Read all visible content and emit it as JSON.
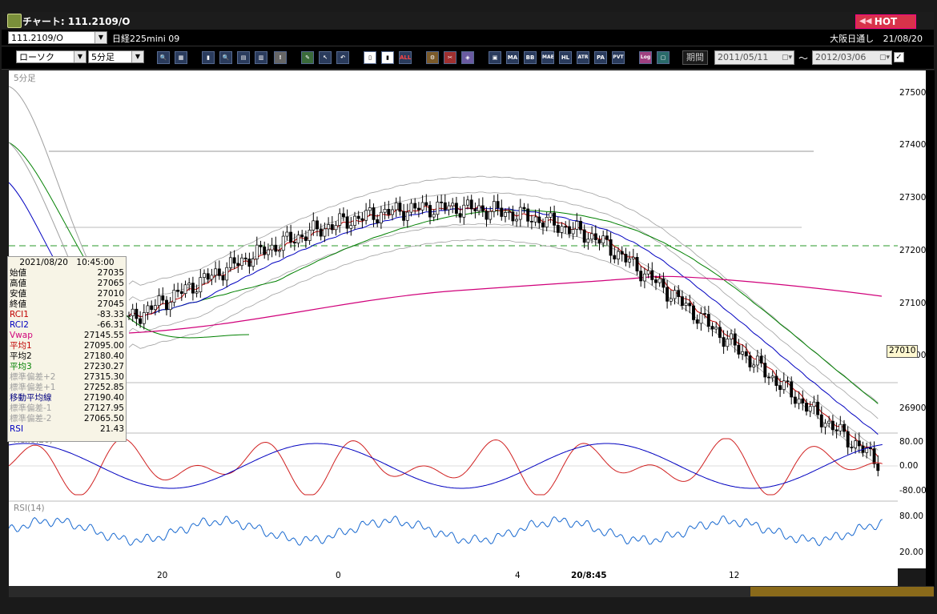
{
  "window": {
    "title": "チャート: 111.2109/O",
    "hot_label": "HOT"
  },
  "header": {
    "symbol_value": "111.2109/O",
    "instrument": "日経225mini 09",
    "session": "大阪日通し",
    "date": "21/08/20"
  },
  "toolbar": {
    "chart_type": "ローソク",
    "timeframe": "5分足",
    "period_label": "期間",
    "date_from": "2011/05/11",
    "date_to": "2012/03/06",
    "range_sep": "～",
    "indicator_buttons": [
      "MA",
      "BB",
      "MAE",
      "HL",
      "ATR",
      "PA",
      "PVT",
      "Log"
    ]
  },
  "chart": {
    "timeframe_label": "5分足",
    "price_ticks": [
      "27500",
      "27400",
      "27300",
      "27200",
      "27100",
      "27000",
      "26900"
    ],
    "current_price": "27010",
    "x_labels": [
      "20",
      "0",
      "4",
      "20/8:45",
      "12"
    ],
    "rci_label": "RCI(9,26)",
    "rci_ticks": [
      "80.00",
      "0.00",
      "-80.00"
    ],
    "rsi_label": "RSI(14)",
    "rsi_ticks": [
      "80.00",
      "20.00"
    ]
  },
  "info_panel": {
    "datetime": "2021/08/20　10:45:00",
    "rows": [
      {
        "label": "始値",
        "value": "27035",
        "color": "#000000"
      },
      {
        "label": "高値",
        "value": "27065",
        "color": "#000000"
      },
      {
        "label": "安値",
        "value": "27010",
        "color": "#000000"
      },
      {
        "label": "終値",
        "value": "27045",
        "color": "#000000"
      },
      {
        "label": "RCI1",
        "value": "-83.33",
        "color": "#c00000"
      },
      {
        "label": "RCI2",
        "value": "-66.31",
        "color": "#0000c0"
      },
      {
        "label": "Vwap",
        "value": "27145.55",
        "color": "#d0007a"
      },
      {
        "label": "平均1",
        "value": "27095.00",
        "color": "#c00000"
      },
      {
        "label": "平均2",
        "value": "27180.40",
        "color": "#000000"
      },
      {
        "label": "平均3",
        "value": "27230.27",
        "color": "#008000"
      },
      {
        "label": "標準偏差+2",
        "value": "27315.30",
        "color": "#a0a0a0"
      },
      {
        "label": "標準偏差+1",
        "value": "27252.85",
        "color": "#a0a0a0"
      },
      {
        "label": "移動平均線",
        "value": "27190.40",
        "color": "#000080"
      },
      {
        "label": "標準偏差-1",
        "value": "27127.95",
        "color": "#a0a0a0"
      },
      {
        "label": "標準偏差-2",
        "value": "27065.50",
        "color": "#a0a0a0"
      },
      {
        "label": "RSI",
        "value": "21.43",
        "color": "#0000c0"
      }
    ]
  },
  "colors": {
    "ma_short": "#c00000",
    "ma_mid": "#0000c0",
    "ma_long": "#008000",
    "vwap": "#d0007a",
    "bands": "#a0a0a0",
    "reference_line": "#2a9a2a"
  }
}
